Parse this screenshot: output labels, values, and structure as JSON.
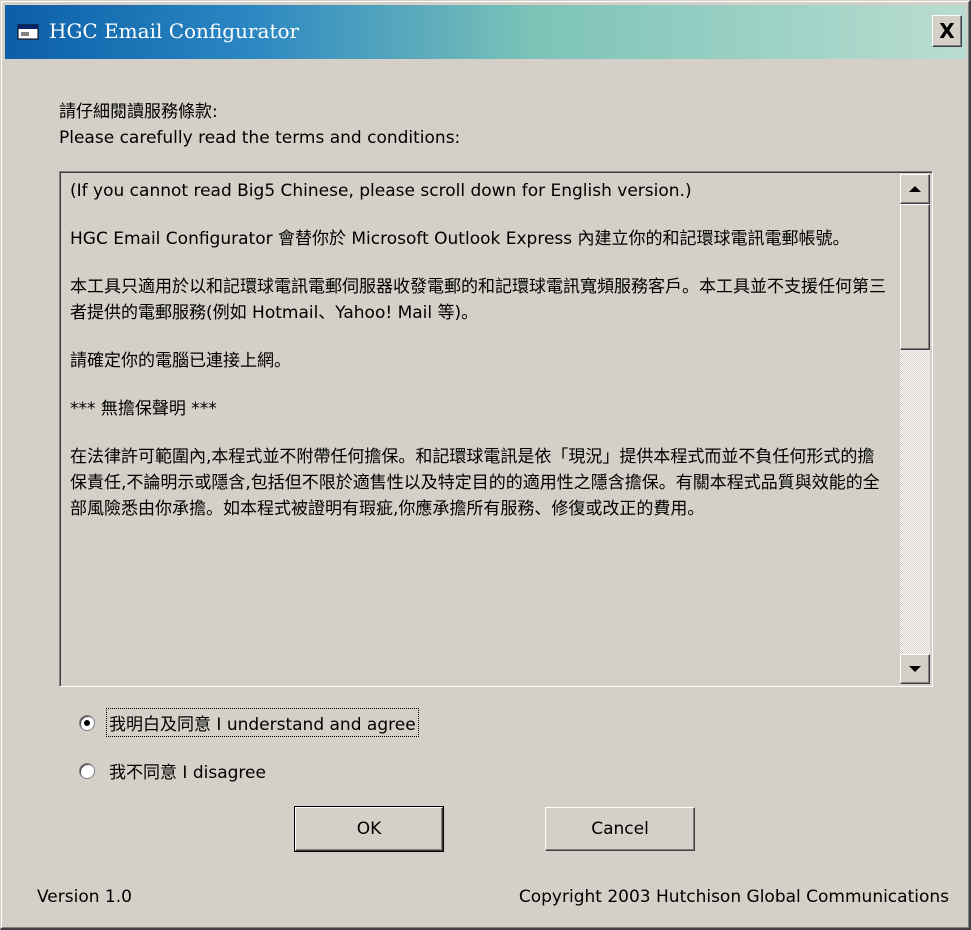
{
  "window": {
    "title": "HGC Email Configurator",
    "close_glyph": "X",
    "title_icon": "mail-window-icon",
    "titlebar_colors": [
      "#0b5fa8",
      "#b9ddd0"
    ]
  },
  "intro": {
    "line_zh": "請仔細閱讀服務條款:",
    "line_en": "Please carefully read the terms and conditions:"
  },
  "terms": {
    "paragraphs": [
      "(If you cannot read Big5 Chinese, please scroll down for English version.)",
      "HGC Email Configurator 會替你於 Microsoft Outlook Express 內建立你的和記環球電訊電郵帳號。",
      "本工具只適用於以和記環球電訊電郵伺服器收發電郵的和記環球電訊寬頻服務客戶。本工具並不支援任何第三者提供的電郵服務(例如 Hotmail、Yahoo! Mail 等)。",
      "請確定你的電腦已連接上網。",
      "*** 無擔保聲明 ***",
      "在法律許可範圍內,本程式並不附帶任何擔保。和記環球電訊是依「現況」提供本程式而並不負任何形式的擔保責任,不論明示或隱含,包括但不限於適售性以及特定目的的適用性之隱含擔保。有關本程式品質與效能的全部風險悉由你承擔。如本程式被證明有瑕疵,你應承擔所有服務、修復或改正的費用。"
    ]
  },
  "options": {
    "agree_label": "我明白及同意 I understand and agree",
    "disagree_label": "我不同意 I disagree",
    "selected": "agree"
  },
  "buttons": {
    "ok_label": "OK",
    "cancel_label": "Cancel"
  },
  "footer": {
    "version": "Version 1.0",
    "copyright": "Copyright 2003 Hutchison Global Communications"
  }
}
